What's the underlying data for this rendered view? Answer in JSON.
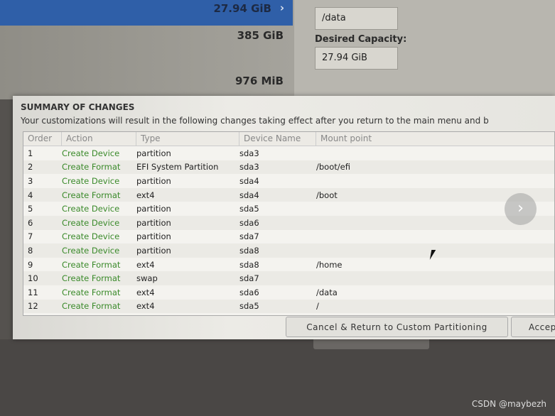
{
  "background": {
    "selected_size": "27.94 GiB",
    "sizes": [
      "385 GiB",
      "976 MiB"
    ],
    "mount_point_value": "/data",
    "desired_capacity_label": "Desired Capacity:",
    "desired_capacity_value": "27.94 GiB"
  },
  "dialog": {
    "title": "SUMMARY OF CHANGES",
    "description": "Your customizations will result in the following changes taking effect after you return to the main menu and b",
    "columns": [
      "Order",
      "Action",
      "Type",
      "Device Name",
      "Mount point"
    ],
    "rows": [
      [
        "1",
        "Create Device",
        "partition",
        "sda3",
        ""
      ],
      [
        "2",
        "Create Format",
        "EFI System Partition",
        "sda3",
        "/boot/efi"
      ],
      [
        "3",
        "Create Device",
        "partition",
        "sda4",
        ""
      ],
      [
        "4",
        "Create Format",
        "ext4",
        "sda4",
        "/boot"
      ],
      [
        "5",
        "Create Device",
        "partition",
        "sda5",
        ""
      ],
      [
        "6",
        "Create Device",
        "partition",
        "sda6",
        ""
      ],
      [
        "7",
        "Create Device",
        "partition",
        "sda7",
        ""
      ],
      [
        "8",
        "Create Device",
        "partition",
        "sda8",
        ""
      ],
      [
        "9",
        "Create Format",
        "ext4",
        "sda8",
        "/home"
      ],
      [
        "10",
        "Create Format",
        "swap",
        "sda7",
        ""
      ],
      [
        "11",
        "Create Format",
        "ext4",
        "sda6",
        "/data"
      ],
      [
        "12",
        "Create Format",
        "ext4",
        "sda5",
        "/"
      ]
    ],
    "cancel_label": "Cancel & Return to Custom Partitioning",
    "accept_label": "Accep"
  },
  "overlay": {
    "next_icon": "chevron-right-icon"
  },
  "watermark": "CSDN @maybezh",
  "colors": {
    "action_green": "#3a8a2a",
    "selection_blue": "#2f5fa8"
  }
}
